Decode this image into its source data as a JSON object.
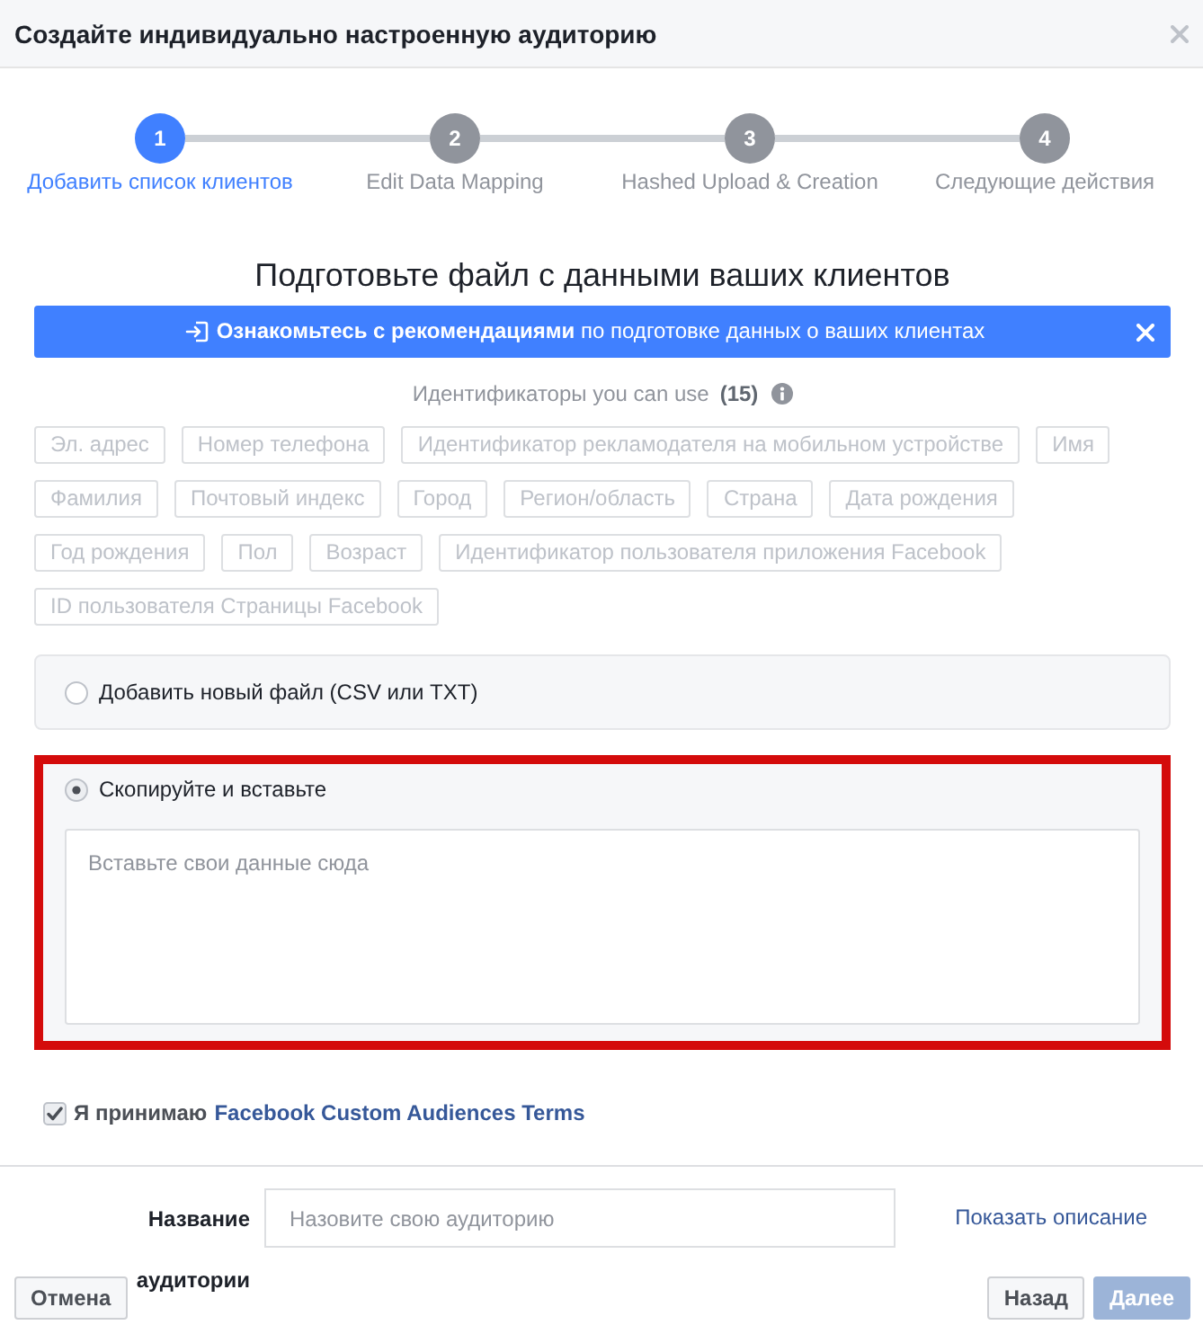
{
  "dialog": {
    "title": "Создайте индивидуально настроенную аудиторию"
  },
  "steps": [
    {
      "number": "1",
      "label": "Добавить список клиентов",
      "selected": true
    },
    {
      "number": "2",
      "label": "Edit Data Mapping",
      "selected": false
    },
    {
      "number": "3",
      "label": "Hashed Upload & Creation",
      "selected": false
    },
    {
      "number": "4",
      "label": "Следующие действия",
      "selected": false
    }
  ],
  "heading": "Подготовьте файл с данными ваших клиентов",
  "banner": {
    "text": "**Ознакомьтесь с рекомендациями** по подготовке данных о ваших клиентах"
  },
  "identifiers": {
    "label": "Идентификаторы you can use",
    "count": "(15)",
    "tags": [
      "Эл. адрес",
      "Номер телефона",
      "Идентификатор рекламодателя на мобильном устройстве",
      "Имя",
      "Фамилия",
      "Почтовый индекс",
      "Город",
      "Регион/область",
      "Страна",
      "Дата рождения",
      "Год рождения",
      "Пол",
      "Возраст",
      "Идентификатор пользователя приложения Facebook",
      "ID пользователя Страницы Facebook"
    ]
  },
  "upload_options": [
    {
      "label": "Добавить новый файл (CSV или TXT)",
      "selected": false,
      "highlighted": false
    },
    {
      "label": "Скопируйте и вставьте",
      "selected": true,
      "highlighted": true,
      "paste_field": {
        "placeholder": "Вставьте свои данные сюда"
      }
    }
  ],
  "terms": {
    "checked": true,
    "text": "Я принимаю",
    "link": "Facebook Custom Audiences Terms"
  },
  "audience_name": {
    "label": "Название аудитории",
    "placeholder": "Назовите свою аудиторию",
    "description_link": "Показать описание"
  },
  "buttons": [
    {
      "label": "Отмена",
      "kind": "cancel",
      "disabled": false
    },
    {
      "label": "Назад",
      "kind": "back",
      "disabled": false
    },
    {
      "label": "Далее",
      "kind": "next",
      "disabled": true
    }
  ]
}
